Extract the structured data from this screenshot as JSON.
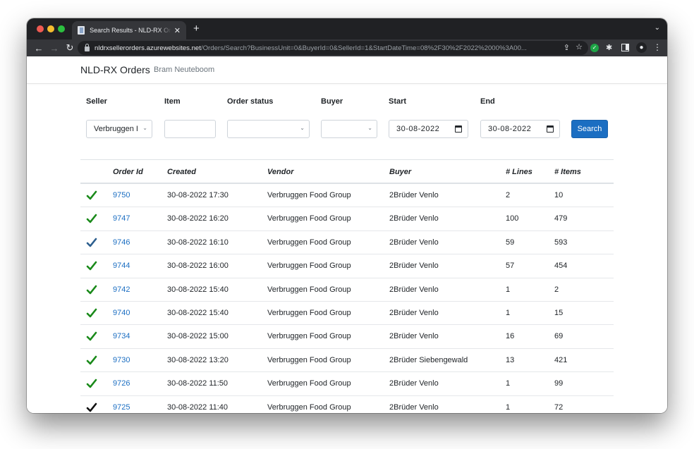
{
  "browser": {
    "tab_title": "Search Results - NLD-RX Orders",
    "new_tab": "+",
    "url_host": "nldrxsellerorders.azurewebsites.net",
    "url_path": "/Orders/Search?BusinessUnit=0&BuyerId=0&SellerId=1&StartDateTime=08%2F30%2F2022%2000%3A00..."
  },
  "navbar": {
    "brand": "NLD-RX Orders",
    "user": "Bram Neuteboom"
  },
  "filters": {
    "seller": {
      "label": "Seller",
      "value": "Verbruggen I"
    },
    "item": {
      "label": "Item",
      "value": ""
    },
    "order_status": {
      "label": "Order status",
      "value": ""
    },
    "buyer": {
      "label": "Buyer",
      "value": ""
    },
    "start": {
      "label": "Start",
      "value": "30-08-2022"
    },
    "end": {
      "label": "End",
      "value": "30-08-2022"
    },
    "search_button": "Search"
  },
  "table": {
    "columns": [
      "",
      "Order Id",
      "Created",
      "Vendor",
      "Buyer",
      "# Lines",
      "# Items"
    ],
    "status_colors": {
      "green": "#1a8a1a",
      "blue": "#2d5f8f",
      "black": "#111111"
    },
    "rows": [
      {
        "status": "green",
        "order_id": "9750",
        "created": "30-08-2022 17:30",
        "vendor": "Verbruggen Food Group",
        "buyer": "2Brüder Venlo",
        "lines": "2",
        "items": "10"
      },
      {
        "status": "green",
        "order_id": "9747",
        "created": "30-08-2022 16:20",
        "vendor": "Verbruggen Food Group",
        "buyer": "2Brüder Venlo",
        "lines": "100",
        "items": "479"
      },
      {
        "status": "blue",
        "order_id": "9746",
        "created": "30-08-2022 16:10",
        "vendor": "Verbruggen Food Group",
        "buyer": "2Brüder Venlo",
        "lines": "59",
        "items": "593"
      },
      {
        "status": "green",
        "order_id": "9744",
        "created": "30-08-2022 16:00",
        "vendor": "Verbruggen Food Group",
        "buyer": "2Brüder Venlo",
        "lines": "57",
        "items": "454"
      },
      {
        "status": "green",
        "order_id": "9742",
        "created": "30-08-2022 15:40",
        "vendor": "Verbruggen Food Group",
        "buyer": "2Brüder Venlo",
        "lines": "1",
        "items": "2"
      },
      {
        "status": "green",
        "order_id": "9740",
        "created": "30-08-2022 15:40",
        "vendor": "Verbruggen Food Group",
        "buyer": "2Brüder Venlo",
        "lines": "1",
        "items": "15"
      },
      {
        "status": "green",
        "order_id": "9734",
        "created": "30-08-2022 15:00",
        "vendor": "Verbruggen Food Group",
        "buyer": "2Brüder Venlo",
        "lines": "16",
        "items": "69"
      },
      {
        "status": "green",
        "order_id": "9730",
        "created": "30-08-2022 13:20",
        "vendor": "Verbruggen Food Group",
        "buyer": "2Brüder Siebengewald",
        "lines": "13",
        "items": "421"
      },
      {
        "status": "green",
        "order_id": "9726",
        "created": "30-08-2022 11:50",
        "vendor": "Verbruggen Food Group",
        "buyer": "2Brüder Venlo",
        "lines": "1",
        "items": "99"
      },
      {
        "status": "black",
        "order_id": "9725",
        "created": "30-08-2022 11:40",
        "vendor": "Verbruggen Food Group",
        "buyer": "2Brüder Venlo",
        "lines": "1",
        "items": "72"
      }
    ]
  }
}
